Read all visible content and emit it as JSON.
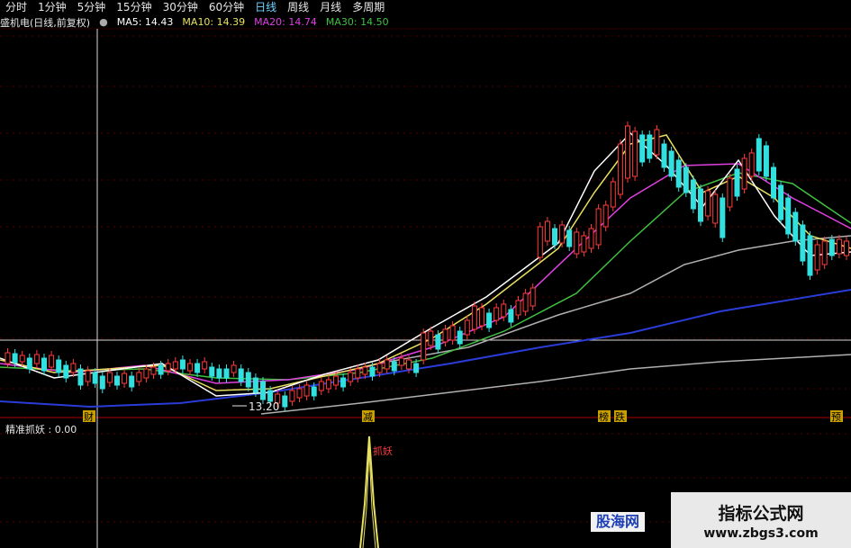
{
  "toolbar": {
    "timeframes": [
      "分时",
      "1分钟",
      "5分钟",
      "15分钟",
      "30分钟",
      "60分钟",
      "日线",
      "周线",
      "月线",
      "多周期"
    ],
    "active": "日线"
  },
  "header": {
    "stock": "盛机电(日线,前复权)",
    "ma5": "MA5: 14.43",
    "ma10": "MA10: 14.39",
    "ma20": "MA20: 14.74",
    "ma30": "MA30: 14.50"
  },
  "indicator": {
    "label": "精准抓妖 : 0.00",
    "signal_label": "抓妖"
  },
  "annotations": {
    "low_price": "13.20",
    "markers": [
      "财",
      "减",
      "榜",
      "跌",
      "预"
    ]
  },
  "watermark": {
    "site": "指标公式网",
    "url": "www.zbgs3.com",
    "left_brand": "股海网"
  },
  "colors": {
    "up": "#ff3b3b",
    "down": "#33e0e0",
    "ma5": "#ffffff",
    "ma10": "#e8e060",
    "ma20": "#e040e0",
    "ma30": "#40c040",
    "ma60": "#b0b0b0",
    "ma120": "#2a3cd8",
    "signal": "#e8e060"
  },
  "chart_data": {
    "type": "candlestick",
    "series": [
      {
        "name": "MA5",
        "values": [
          14.43
        ]
      },
      {
        "name": "MA10",
        "values": [
          14.39
        ]
      },
      {
        "name": "MA20",
        "values": [
          14.74
        ]
      },
      {
        "name": "MA30",
        "values": [
          14.5
        ]
      }
    ],
    "annotations": [
      "13.20"
    ],
    "indicator": {
      "name": "精准抓妖",
      "value": 0.0,
      "signal": "抓妖"
    },
    "candles": [
      [
        0,
        "u",
        392,
        404
      ],
      [
        1,
        "d",
        393,
        403
      ],
      [
        2,
        "u",
        395,
        402
      ],
      [
        3,
        "d",
        398,
        410
      ],
      [
        4,
        "u",
        394,
        404
      ],
      [
        5,
        "d",
        398,
        412
      ],
      [
        6,
        "u",
        395,
        408
      ],
      [
        7,
        "d",
        400,
        414
      ],
      [
        8,
        "d",
        406,
        420
      ],
      [
        9,
        "u",
        404,
        414
      ],
      [
        10,
        "d",
        410,
        428
      ],
      [
        11,
        "u",
        412,
        424
      ],
      [
        12,
        "d",
        414,
        426
      ],
      [
        13,
        "d",
        418,
        432
      ],
      [
        14,
        "u",
        414,
        425
      ],
      [
        15,
        "d",
        418,
        428
      ],
      [
        16,
        "u",
        415,
        426
      ],
      [
        17,
        "d",
        418,
        430
      ],
      [
        18,
        "u",
        414,
        424
      ],
      [
        19,
        "u",
        410,
        420
      ],
      [
        20,
        "u",
        408,
        416
      ],
      [
        21,
        "d",
        406,
        416
      ],
      [
        22,
        "u",
        404,
        412
      ],
      [
        23,
        "u",
        402,
        410
      ],
      [
        24,
        "d",
        400,
        410
      ],
      [
        25,
        "u",
        404,
        412
      ],
      [
        26,
        "d",
        404,
        414
      ],
      [
        27,
        "u",
        402,
        410
      ],
      [
        28,
        "d",
        408,
        418
      ],
      [
        29,
        "d",
        410,
        420
      ],
      [
        30,
        "d",
        410,
        420
      ],
      [
        31,
        "u",
        406,
        414
      ],
      [
        32,
        "d",
        410,
        424
      ],
      [
        33,
        "d",
        414,
        430
      ],
      [
        34,
        "d",
        420,
        436
      ],
      [
        35,
        "d",
        424,
        444
      ],
      [
        36,
        "d",
        434,
        446
      ],
      [
        37,
        "u",
        438,
        448
      ],
      [
        38,
        "d",
        440,
        452
      ],
      [
        39,
        "u",
        434,
        446
      ],
      [
        40,
        "u",
        432,
        442
      ],
      [
        41,
        "u",
        428,
        440
      ],
      [
        42,
        "d",
        430,
        440
      ],
      [
        43,
        "u",
        424,
        434
      ],
      [
        44,
        "u",
        422,
        432
      ],
      [
        45,
        "u",
        418,
        428
      ],
      [
        46,
        "d",
        420,
        430
      ],
      [
        47,
        "u",
        414,
        424
      ],
      [
        48,
        "u",
        410,
        420
      ],
      [
        49,
        "u",
        408,
        416
      ],
      [
        50,
        "d",
        408,
        418
      ],
      [
        51,
        "u",
        404,
        414
      ],
      [
        52,
        "u",
        400,
        410
      ],
      [
        53,
        "d",
        402,
        412
      ],
      [
        54,
        "u",
        398,
        406
      ],
      [
        55,
        "u",
        400,
        410
      ],
      [
        56,
        "d",
        404,
        414
      ],
      [
        57,
        "u",
        370,
        400
      ],
      [
        58,
        "u",
        368,
        384
      ],
      [
        59,
        "d",
        372,
        388
      ],
      [
        60,
        "u",
        366,
        380
      ],
      [
        61,
        "u",
        362,
        378
      ],
      [
        62,
        "d",
        368,
        382
      ],
      [
        63,
        "u",
        356,
        372
      ],
      [
        64,
        "u",
        340,
        366
      ],
      [
        65,
        "u",
        342,
        362
      ],
      [
        66,
        "d",
        348,
        364
      ],
      [
        67,
        "u",
        342,
        356
      ],
      [
        68,
        "u",
        338,
        352
      ],
      [
        69,
        "d",
        344,
        358
      ],
      [
        70,
        "u",
        334,
        350
      ],
      [
        71,
        "u",
        326,
        346
      ],
      [
        72,
        "u",
        320,
        340
      ],
      [
        73,
        "u",
        252,
        286
      ],
      [
        74,
        "u",
        246,
        268
      ],
      [
        75,
        "d",
        254,
        272
      ],
      [
        76,
        "u",
        250,
        270
      ],
      [
        77,
        "d",
        256,
        274
      ],
      [
        78,
        "u",
        258,
        282
      ],
      [
        79,
        "u",
        262,
        280
      ],
      [
        80,
        "u",
        254,
        276
      ],
      [
        81,
        "u",
        232,
        272
      ],
      [
        82,
        "u",
        228,
        252
      ],
      [
        83,
        "u",
        202,
        230
      ],
      [
        84,
        "u",
        160,
        216
      ],
      [
        85,
        "u",
        140,
        198
      ],
      [
        86,
        "u",
        146,
        196
      ],
      [
        87,
        "d",
        150,
        180
      ],
      [
        88,
        "d",
        150,
        176
      ],
      [
        89,
        "u",
        144,
        172
      ],
      [
        90,
        "d",
        160,
        186
      ],
      [
        91,
        "d",
        168,
        196
      ],
      [
        92,
        "d",
        178,
        208
      ],
      [
        93,
        "d",
        186,
        214
      ],
      [
        94,
        "d",
        200,
        232
      ],
      [
        95,
        "d",
        210,
        246
      ],
      [
        96,
        "u",
        212,
        240
      ],
      [
        97,
        "u",
        216,
        248
      ],
      [
        98,
        "d",
        220,
        264
      ],
      [
        99,
        "u",
        198,
        230
      ],
      [
        100,
        "d",
        188,
        218
      ],
      [
        101,
        "u",
        176,
        210
      ],
      [
        102,
        "u",
        170,
        196
      ],
      [
        103,
        "d",
        154,
        190
      ],
      [
        104,
        "d",
        162,
        196
      ],
      [
        105,
        "d",
        186,
        220
      ],
      [
        106,
        "d",
        206,
        244
      ],
      [
        107,
        "d",
        220,
        260
      ],
      [
        108,
        "d",
        236,
        268
      ],
      [
        109,
        "d",
        250,
        290
      ],
      [
        110,
        "d",
        262,
        306
      ],
      [
        111,
        "u",
        272,
        300
      ],
      [
        112,
        "u",
        268,
        294
      ],
      [
        113,
        "d",
        266,
        284
      ],
      [
        114,
        "u",
        266,
        282
      ],
      [
        115,
        "u",
        268,
        284
      ]
    ]
  }
}
